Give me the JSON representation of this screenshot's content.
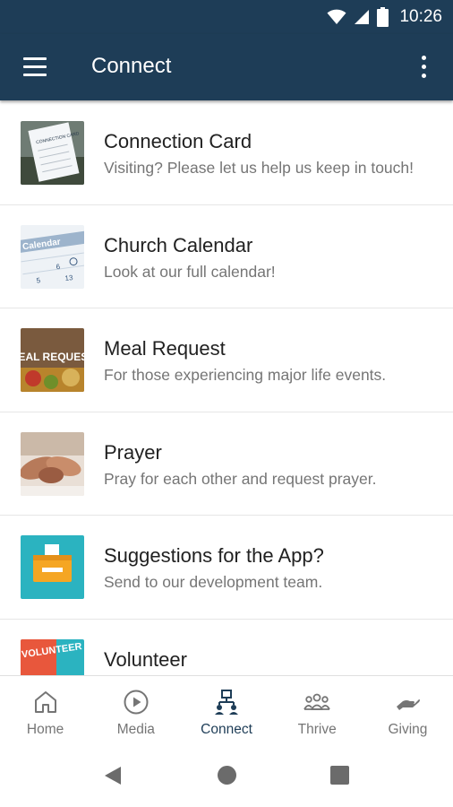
{
  "status_bar": {
    "time": "10:26"
  },
  "app_bar": {
    "title": "Connect"
  },
  "items": [
    {
      "title": "Connection Card",
      "subtitle": "Visiting? Please let us help us keep in touch!",
      "thumb_text": "CONNECTION CARD"
    },
    {
      "title": "Church Calendar",
      "subtitle": "Look at our full calendar!",
      "thumb_text": "Calendar"
    },
    {
      "title": "Meal Request",
      "subtitle": "For those experiencing major life events.",
      "thumb_text": "MEAL REQUEST"
    },
    {
      "title": "Prayer",
      "subtitle": "Pray for each other and request prayer."
    },
    {
      "title": "Suggestions for the App?",
      "subtitle": "Send to our development team."
    },
    {
      "title": "Volunteer",
      "subtitle": "",
      "thumb_text": "VOLUNTEER NEEDED"
    }
  ],
  "bottom_nav": [
    {
      "label": "Home",
      "icon": "home-icon",
      "active": false
    },
    {
      "label": "Media",
      "icon": "play-circle-icon",
      "active": false
    },
    {
      "label": "Connect",
      "icon": "connect-icon",
      "active": true
    },
    {
      "label": "Thrive",
      "icon": "group-icon",
      "active": false
    },
    {
      "label": "Giving",
      "icon": "giving-hand-icon",
      "active": false
    }
  ],
  "colors": {
    "primary": "#1e3d57",
    "active_nav": "#1e3d57",
    "inactive_nav": "#757575"
  }
}
